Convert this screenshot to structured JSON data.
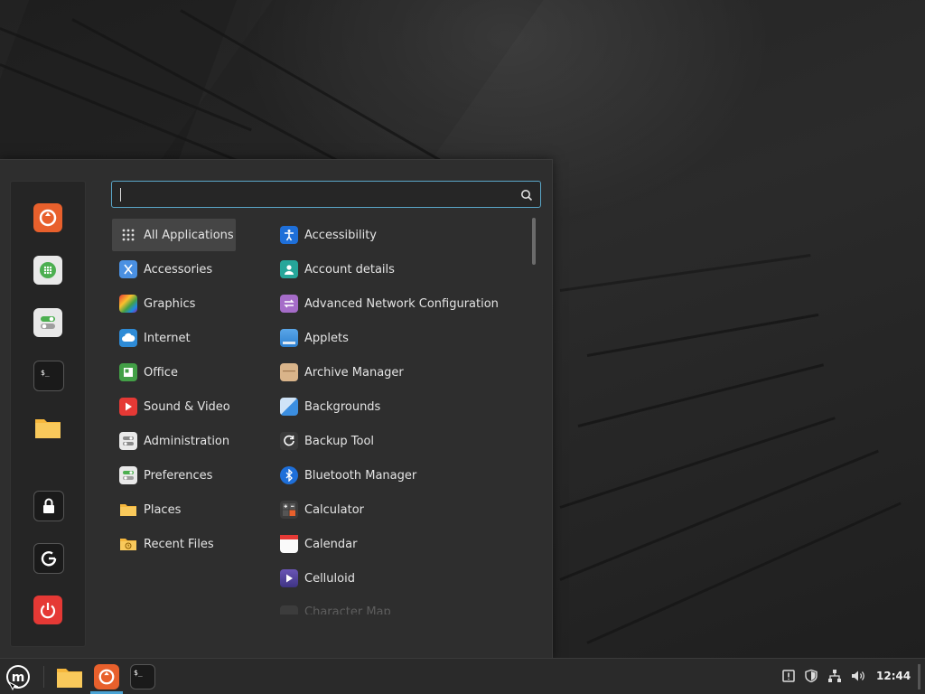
{
  "search": {
    "value": "",
    "placeholder": ""
  },
  "sidebar": {
    "favorites": [
      {
        "name": "firefox-icon"
      },
      {
        "name": "software-manager-icon"
      },
      {
        "name": "system-settings-icon"
      },
      {
        "name": "terminal-icon"
      },
      {
        "name": "files-icon"
      }
    ],
    "session": [
      {
        "name": "lock-screen-icon"
      },
      {
        "name": "logout-icon"
      },
      {
        "name": "shutdown-icon"
      }
    ]
  },
  "categories": [
    {
      "label": "All Applications",
      "icon": "grid-icon"
    },
    {
      "label": "Accessories",
      "icon": "accessories-icon"
    },
    {
      "label": "Graphics",
      "icon": "graphics-icon"
    },
    {
      "label": "Internet",
      "icon": "internet-cloud-icon"
    },
    {
      "label": "Office",
      "icon": "office-icon"
    },
    {
      "label": "Sound & Video",
      "icon": "play-icon"
    },
    {
      "label": "Administration",
      "icon": "administration-icon"
    },
    {
      "label": "Preferences",
      "icon": "preferences-icon"
    },
    {
      "label": "Places",
      "icon": "folder-icon"
    },
    {
      "label": "Recent Files",
      "icon": "recent-folder-icon"
    }
  ],
  "apps": [
    {
      "label": "Accessibility",
      "icon": "accessibility-icon"
    },
    {
      "label": "Account details",
      "icon": "account-icon"
    },
    {
      "label": "Advanced Network Configuration",
      "icon": "network-config-icon"
    },
    {
      "label": "Applets",
      "icon": "applets-icon"
    },
    {
      "label": "Archive Manager",
      "icon": "archive-icon"
    },
    {
      "label": "Backgrounds",
      "icon": "backgrounds-icon"
    },
    {
      "label": "Backup Tool",
      "icon": "backup-icon"
    },
    {
      "label": "Bluetooth Manager",
      "icon": "bluetooth-icon"
    },
    {
      "label": "Calculator",
      "icon": "calculator-icon"
    },
    {
      "label": "Calendar",
      "icon": "calendar-icon"
    },
    {
      "label": "Celluloid",
      "icon": "celluloid-icon"
    },
    {
      "label": "Character Map",
      "icon": "character-map-icon"
    }
  ],
  "panel": {
    "clock": "12:44",
    "tray": [
      "update-icon",
      "shield-icon",
      "network-icon",
      "volume-icon"
    ]
  },
  "colors": {
    "accent": "#5aa6c8",
    "firefox": "#e8602c",
    "power": "#e53935"
  }
}
